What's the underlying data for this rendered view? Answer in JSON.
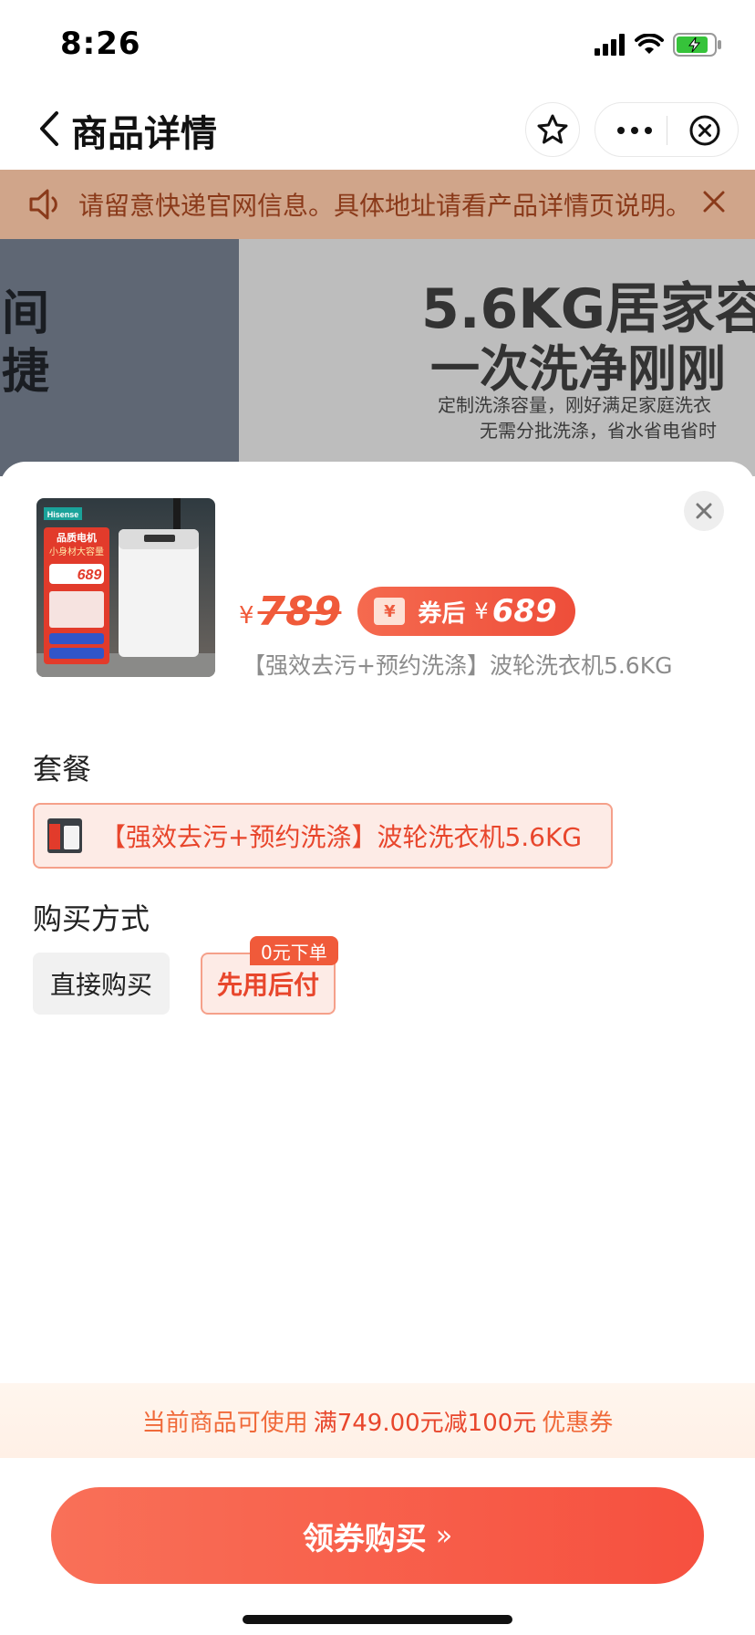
{
  "status_bar": {
    "time": "8:26"
  },
  "nav": {
    "title": "商品详情"
  },
  "notice": {
    "text": "请留意快递官网信息。具体地址请看产品详情页说明。"
  },
  "banner": {
    "left_text_line1": "间",
    "left_text_line2": "捷",
    "headline1": "5.6KG居家容",
    "headline2": "一次洗净刚刚",
    "sub1": "定制洗涤容量，刚好满足家庭洗衣",
    "sub2": "无需分批洗涤，省水省电省时"
  },
  "product": {
    "thumb_brand": "Hisense",
    "thumb_badge1": "品质电机",
    "thumb_badge2": "小身材大容量",
    "thumb_price": "689",
    "currency": "¥",
    "original_price": "789",
    "coupon_label": "券后",
    "coupon_currency": "¥",
    "coupon_price": "689",
    "subtitle": "【强效去污+预约洗涤】波轮洗衣机5.6KG"
  },
  "package": {
    "title": "套餐",
    "option_label": "【强效去污+预约洗涤】波轮洗衣机5.6KG"
  },
  "purchase": {
    "title": "购买方式",
    "direct_label": "直接购买",
    "later_label": "先用后付",
    "later_tag": "0元下单"
  },
  "coupon_bar": {
    "prefix": "当前商品可使用",
    "highlight": "满749.00元减100元",
    "suffix": "优惠券"
  },
  "cta": {
    "label": "领券购买",
    "arrow": "»"
  },
  "colors": {
    "accent": "#f05a3a",
    "notice_bg": "#d0a58a"
  }
}
